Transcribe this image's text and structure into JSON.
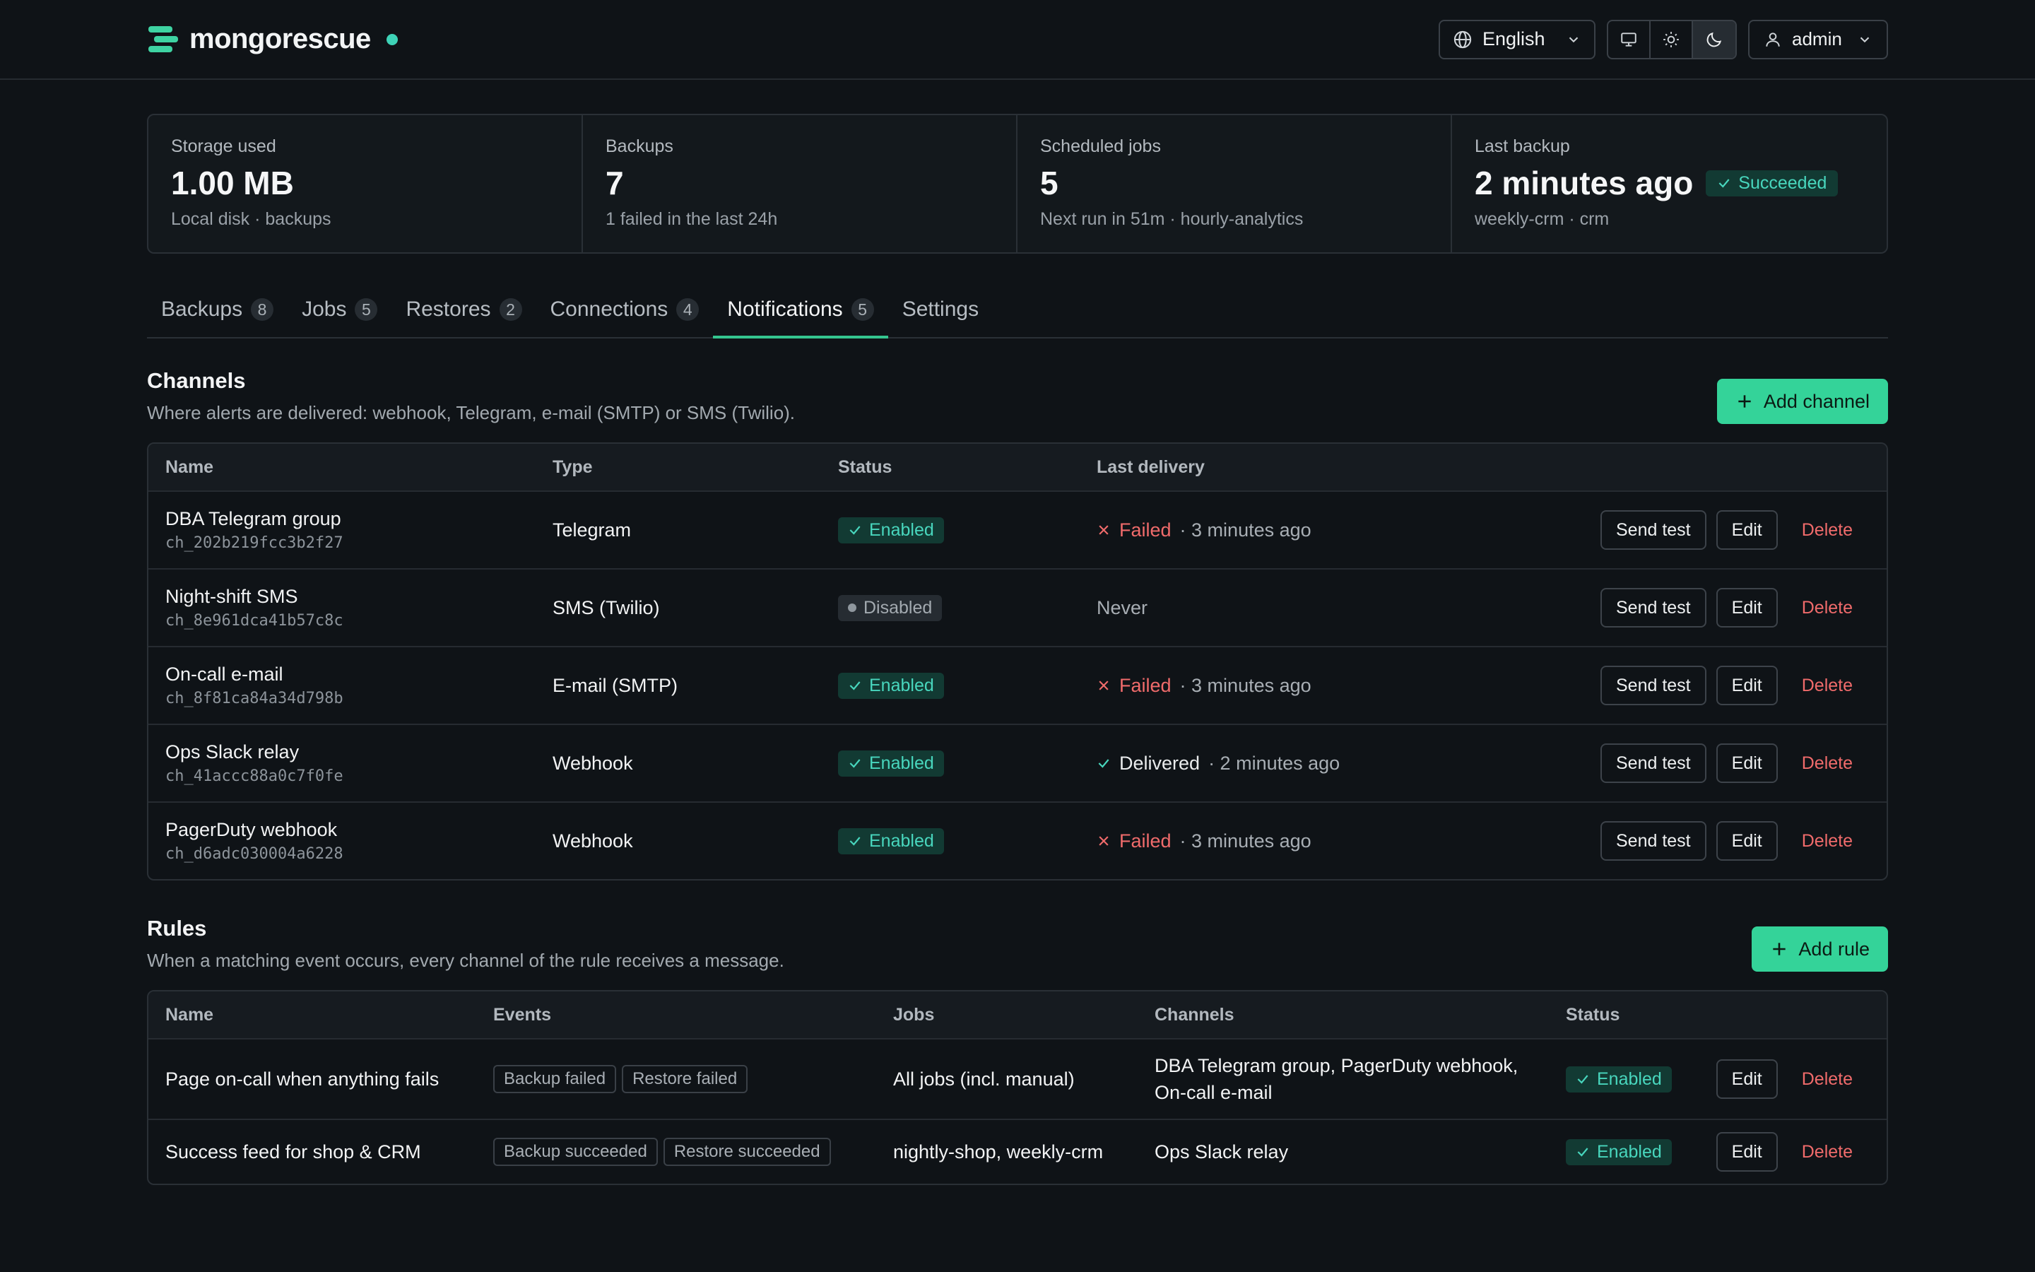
{
  "brand": {
    "name": "mongorescue"
  },
  "header": {
    "language": "English",
    "theme_options": [
      "monitor-icon",
      "sun-icon",
      "moon-icon"
    ],
    "user": "admin"
  },
  "stats": [
    {
      "label": "Storage used",
      "value": "1.00 MB",
      "sub": "Local disk · backups"
    },
    {
      "label": "Backups",
      "value": "7",
      "sub": "1 failed in the last 24h"
    },
    {
      "label": "Scheduled jobs",
      "value": "5",
      "sub": "Next run in 51m · hourly-analytics"
    },
    {
      "label": "Last backup",
      "value": "2 minutes ago",
      "badge": "Succeeded",
      "sub": "weekly-crm · crm"
    }
  ],
  "tabs": [
    {
      "label": "Backups",
      "count": "8"
    },
    {
      "label": "Jobs",
      "count": "5"
    },
    {
      "label": "Restores",
      "count": "2"
    },
    {
      "label": "Connections",
      "count": "4"
    },
    {
      "label": "Notifications",
      "count": "5"
    },
    {
      "label": "Settings",
      "count": ""
    }
  ],
  "channels": {
    "title": "Channels",
    "description": "Where alerts are delivered: webhook, Telegram, e-mail (SMTP) or SMS (Twilio).",
    "add_label": "Add channel",
    "headers": [
      "Name",
      "Type",
      "Status",
      "Last delivery"
    ],
    "rows": [
      {
        "name": "DBA Telegram group",
        "id": "ch_202b219fcc3b2f27",
        "type": "Telegram",
        "status": "Enabled",
        "delivery_state": "Failed",
        "delivery_time": "· 3 minutes ago"
      },
      {
        "name": "Night-shift SMS",
        "id": "ch_8e961dca41b57c8c",
        "type": "SMS (Twilio)",
        "status": "Disabled",
        "delivery_state": "Never",
        "delivery_time": ""
      },
      {
        "name": "On-call e-mail",
        "id": "ch_8f81ca84a34d798b",
        "type": "E-mail (SMTP)",
        "status": "Enabled",
        "delivery_state": "Failed",
        "delivery_time": "· 3 minutes ago"
      },
      {
        "name": "Ops Slack relay",
        "id": "ch_41accc88a0c7f0fe",
        "type": "Webhook",
        "status": "Enabled",
        "delivery_state": "Delivered",
        "delivery_time": "· 2 minutes ago"
      },
      {
        "name": "PagerDuty webhook",
        "id": "ch_d6adc030004a6228",
        "type": "Webhook",
        "status": "Enabled",
        "delivery_state": "Failed",
        "delivery_time": "· 3 minutes ago"
      }
    ],
    "actions": {
      "send_test": "Send test",
      "edit": "Edit",
      "delete": "Delete"
    }
  },
  "rules": {
    "title": "Rules",
    "description": "When a matching event occurs, every channel of the rule receives a message.",
    "add_label": "Add rule",
    "headers": [
      "Name",
      "Events",
      "Jobs",
      "Channels",
      "Status"
    ],
    "rows": [
      {
        "name": "Page on-call when anything fails",
        "events": [
          "Backup failed",
          "Restore failed"
        ],
        "jobs": "All jobs (incl. manual)",
        "channels_line1": "DBA Telegram group, PagerDuty webhook,",
        "channels_line2": "On-call e-mail",
        "status": "Enabled"
      },
      {
        "name": "Success feed for shop & CRM",
        "events": [
          "Backup succeeded",
          "Restore succeeded"
        ],
        "jobs": "nightly-shop, weekly-crm",
        "channels_line1": "Ops Slack relay",
        "channels_line2": "",
        "status": "Enabled"
      }
    ],
    "actions": {
      "edit": "Edit",
      "delete": "Delete"
    }
  },
  "colors": {
    "accent": "#34d399",
    "success_text": "#48d6bd",
    "danger": "#f06b6b",
    "background": "#0f1317"
  }
}
